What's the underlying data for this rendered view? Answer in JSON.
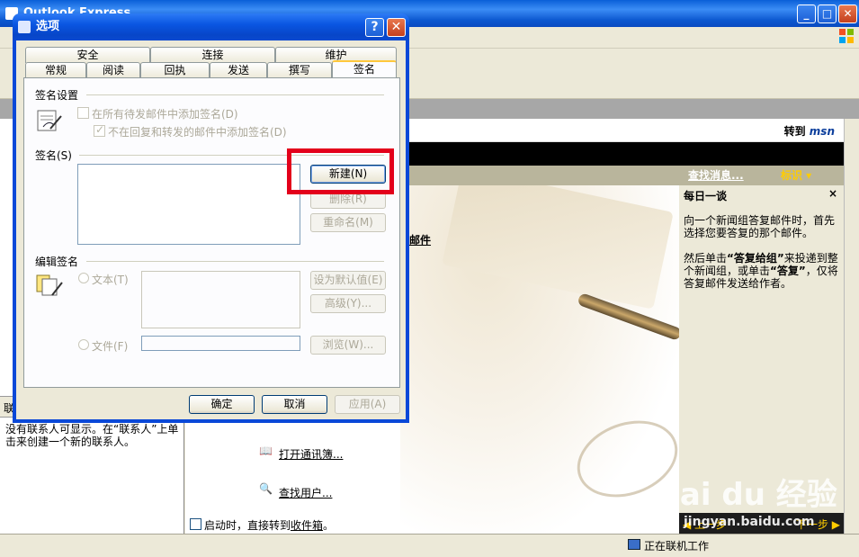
{
  "main_window": {
    "title": "Outlook Express",
    "buttons": {
      "minimize": "_",
      "maximize": "□",
      "close": "✕"
    }
  },
  "msn": {
    "goto_label": "转到",
    "logo_text": "msn"
  },
  "content": {
    "find_messages": "查找消息...",
    "identity": "标识 ▾",
    "partial_link": "邮件",
    "open_address_book": "打开通讯簿...",
    "find_people": "查找用户...",
    "startup_checkbox": "启动时，直接转到",
    "startup_link": "收件箱",
    "startup_period": "。"
  },
  "contacts": {
    "header": "联",
    "empty_text": "没有联系人可显示。在“联系人”上单击来创建一个新的联系人。"
  },
  "tip": {
    "title": "每日一谈",
    "close": "×",
    "para1": "向一个新闻组答复邮件时，首先选择您要答复的那个邮件。",
    "para2_a": "然后单击",
    "para2_b": "“答复给组”",
    "para2_c": "来投递到整个新闻组，或单击",
    "para2_d": "“答复”",
    "para2_e": "，仅将答复邮件发送给作者。",
    "prev": "◀ 上一步",
    "next": "下一步 ▶"
  },
  "status": {
    "online": "正在联机工作"
  },
  "watermark": {
    "brand": "Bai du 经验",
    "url": "jingyan.baidu.com"
  },
  "dialog": {
    "title": "选项",
    "help": "?",
    "close": "✕",
    "tabs_back": [
      "安全",
      "连接",
      "维护"
    ],
    "tabs_front": [
      "常规",
      "阅读",
      "回执",
      "发送",
      "撰写",
      "签名"
    ],
    "active_tab": "签名",
    "sig_settings": {
      "label": "签名设置",
      "add_to_all": "在所有待发邮件中添加签名(D)",
      "no_reply_forward": "不在回复和转发的邮件中添加签名(D)"
    },
    "signatures": {
      "label": "签名(S)",
      "new": "新建(N)",
      "remove": "删除(R)",
      "rename": "重命名(M)"
    },
    "edit_sig": {
      "label": "编辑签名",
      "text_option": "文本(T)",
      "file_option": "文件(F)",
      "set_default": "设为默认值(E)",
      "advanced": "高级(Y)...",
      "browse": "浏览(W)..."
    },
    "buttons": {
      "ok": "确定",
      "cancel": "取消",
      "apply": "应用(A)"
    }
  }
}
